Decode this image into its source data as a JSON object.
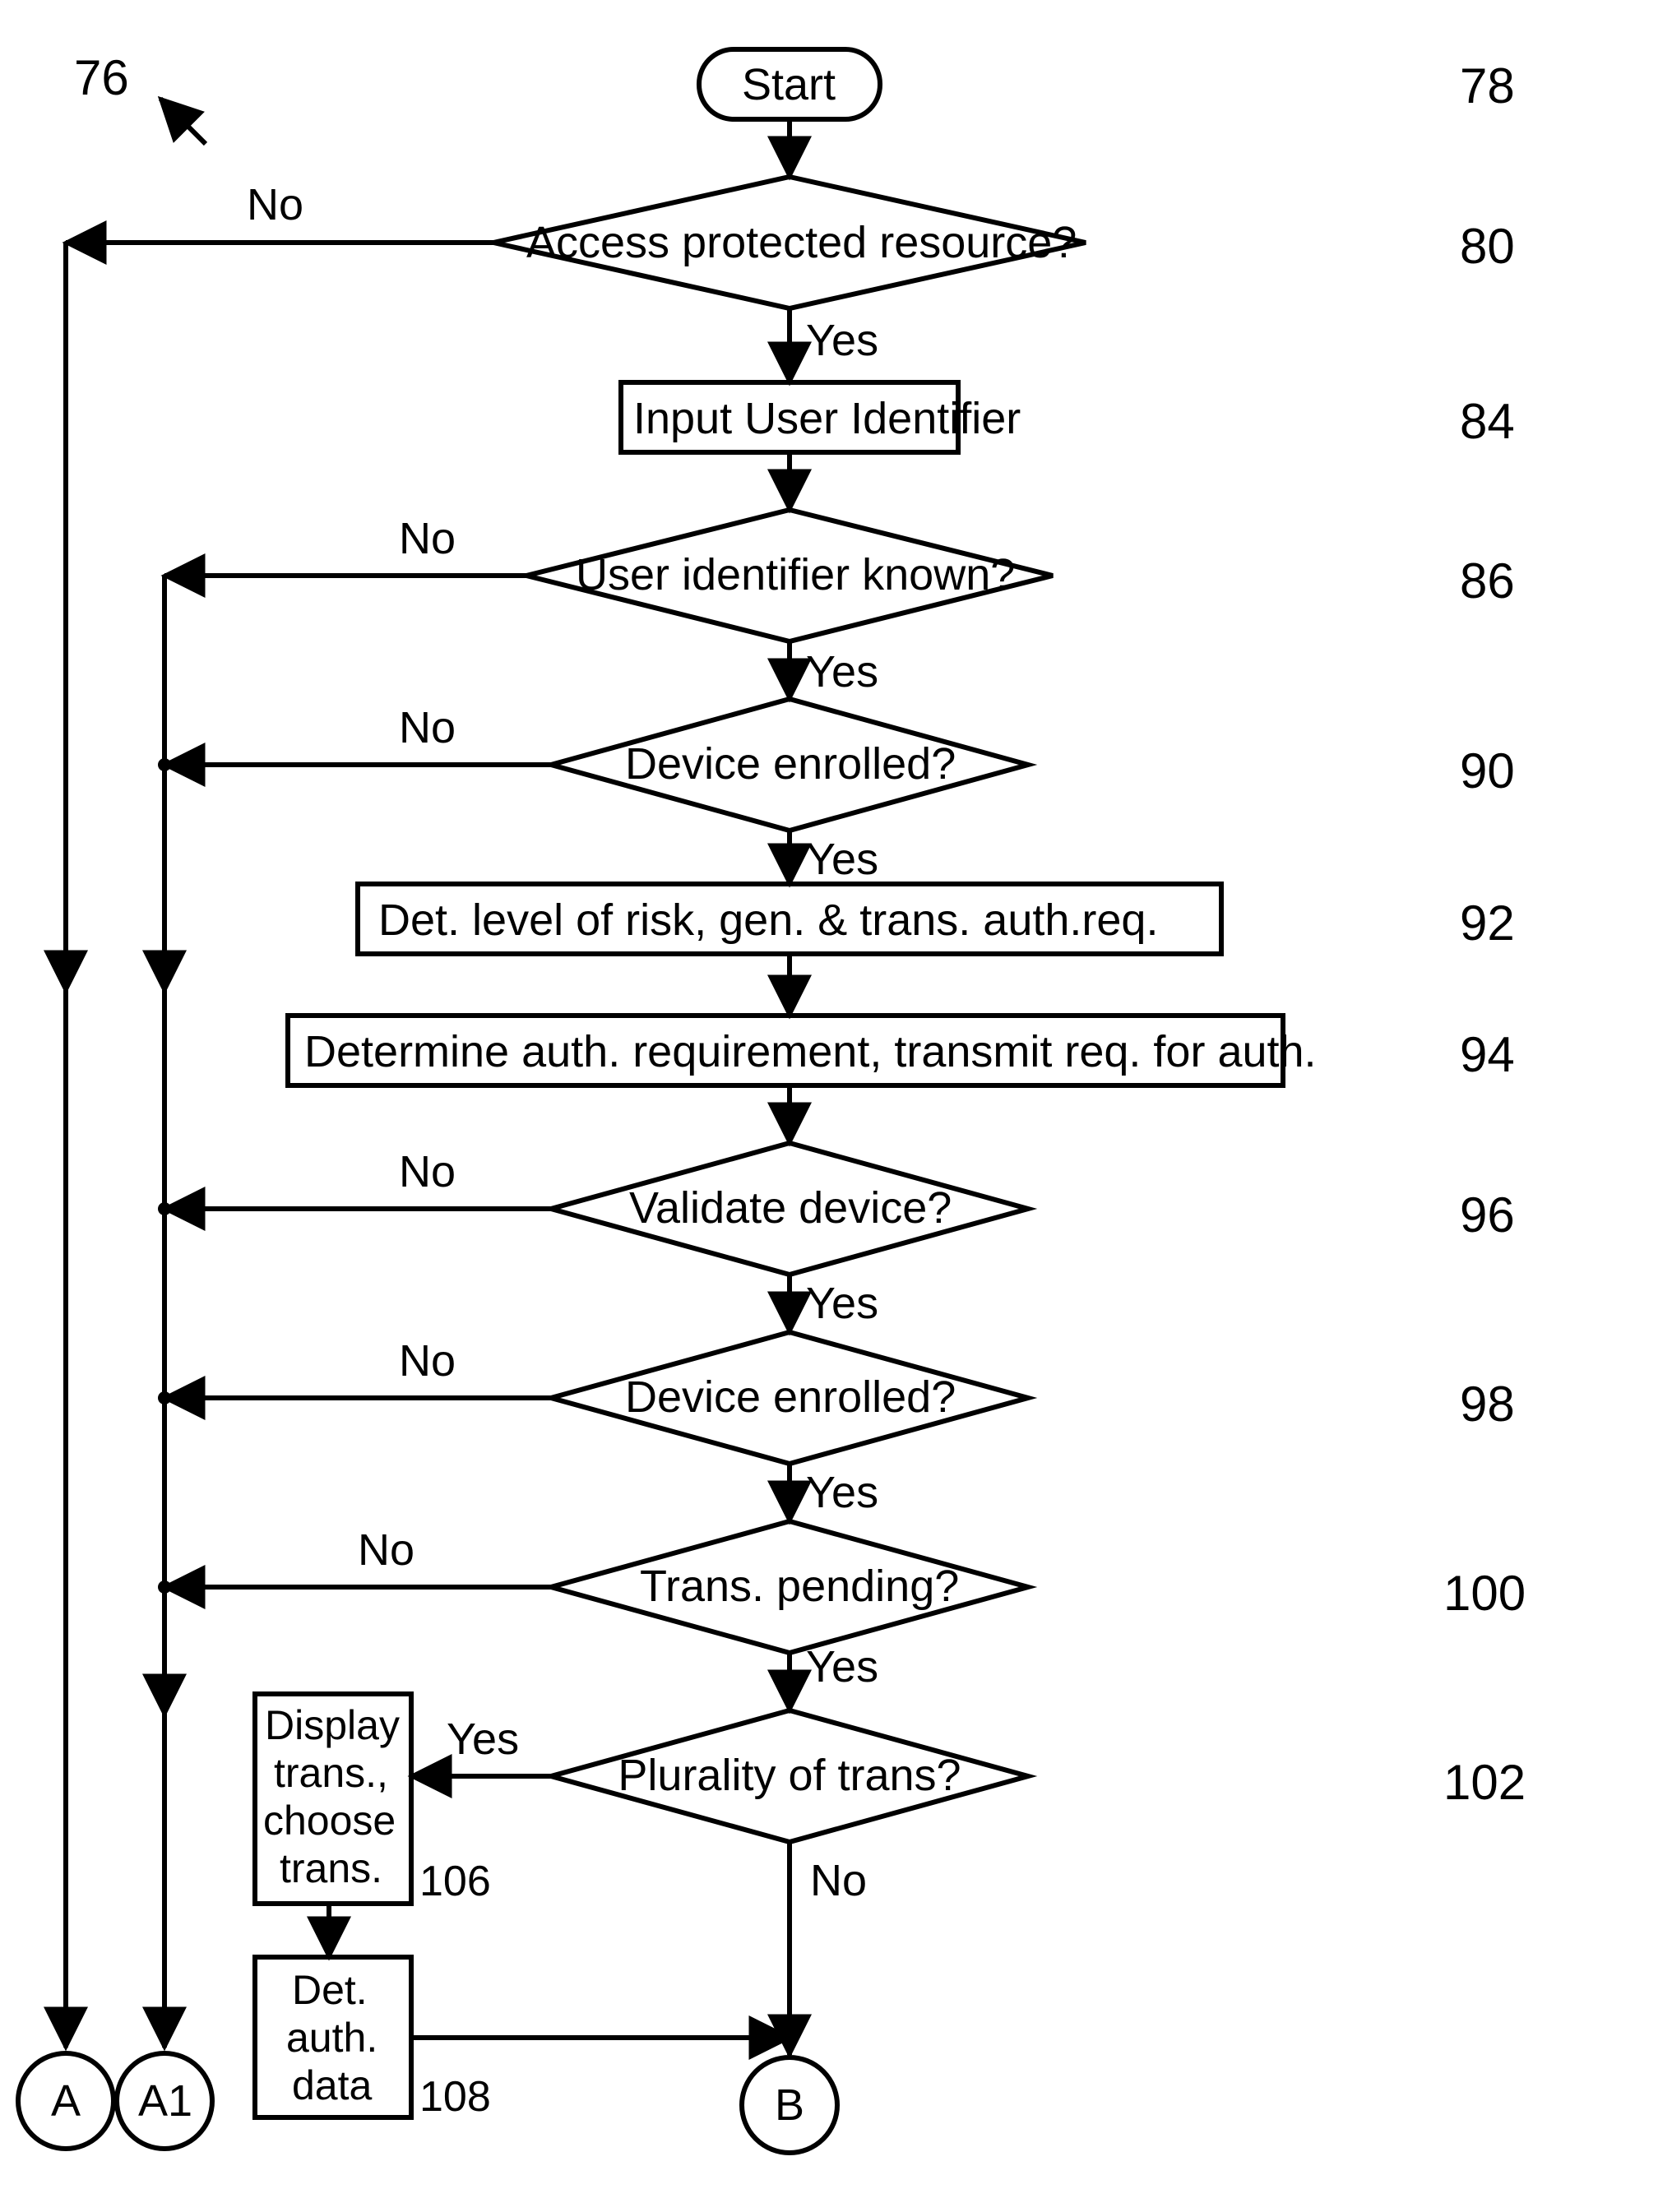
{
  "refs": {
    "r76": "76",
    "r78": "78",
    "r80": "80",
    "r84": "84",
    "r86": "86",
    "r90": "90",
    "r92": "92",
    "r94": "94",
    "r96": "96",
    "r98": "98",
    "r100": "100",
    "r102": "102",
    "r106": "106",
    "r108": "108"
  },
  "nodes": {
    "start": "Start",
    "d80": "Access protected resource?",
    "p84": "Input User Identifier",
    "d86": "User identifier known?",
    "d90": "Device enrolled?",
    "p92": "Det. level of risk, gen. & trans. auth.req.",
    "p94": "Determine auth. requirement, transmit req. for auth.",
    "d96": "Validate device?",
    "d98": "Device enrolled?",
    "d100": "Trans. pending?",
    "d102": "Plurality of trans?",
    "p106_l1": "Display",
    "p106_l2": "trans.,",
    "p106_l3": "choose",
    "p106_l4": "trans.",
    "p108_l1": "Det.",
    "p108_l2": "auth.",
    "p108_l3": "data",
    "connA": "A",
    "connA1": "A1",
    "connB": "B"
  },
  "edges": {
    "yes": "Yes",
    "no": "No"
  }
}
